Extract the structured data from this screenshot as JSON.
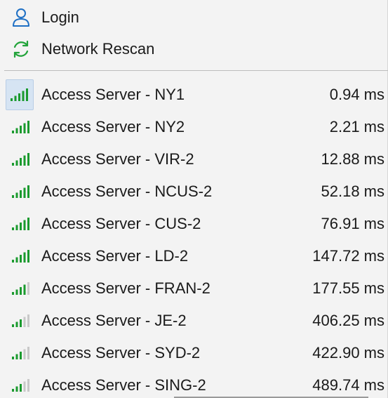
{
  "menu": {
    "actions": [
      {
        "label": "Login",
        "icon": "user-icon"
      },
      {
        "label": "Network Rescan",
        "icon": "refresh-icon"
      }
    ],
    "servers": [
      {
        "label": "Access Server - NY1",
        "latency": "0.94 ms",
        "signal": 5
      },
      {
        "label": "Access Server - NY2",
        "latency": "2.21 ms",
        "signal": 5
      },
      {
        "label": "Access Server - VIR-2",
        "latency": "12.88 ms",
        "signal": 5
      },
      {
        "label": "Access Server - NCUS-2",
        "latency": "52.18 ms",
        "signal": 5
      },
      {
        "label": "Access Server - CUS-2",
        "latency": "76.91 ms",
        "signal": 5
      },
      {
        "label": "Access Server - LD-2",
        "latency": "147.72 ms",
        "signal": 5
      },
      {
        "label": "Access Server - FRAN-2",
        "latency": "177.55 ms",
        "signal": 4
      },
      {
        "label": "Access Server - JE-2",
        "latency": "406.25 ms",
        "signal": 3
      },
      {
        "label": "Access Server - SYD-2",
        "latency": "422.90 ms",
        "signal": 3
      },
      {
        "label": "Access Server - SING-2",
        "latency": "489.74 ms",
        "signal": 3
      }
    ],
    "colors": {
      "signal_active": "#1a9a2e",
      "signal_inactive": "#c8c8c8",
      "user_icon": "#1e6fc4",
      "refresh_icon": "#22a33a"
    }
  }
}
